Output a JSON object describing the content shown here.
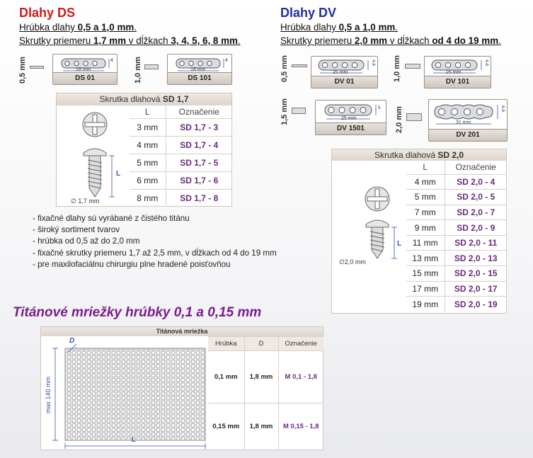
{
  "ds": {
    "title": "Dlahy DS",
    "spec1_pre": "Hrúbka dlahy ",
    "spec1_val": "0,5 a 1,0 mm",
    "spec1_post": ".",
    "spec2_pre": "Skrutky priemeru ",
    "spec2_val1": "1,7 mm",
    "spec2_mid": " v dĺžkach ",
    "spec2_val2": "3, 4, 5, 6, 8 mm",
    "spec2_post": ".",
    "plates": [
      {
        "thickness": "0,5 mm",
        "label": "DS 01",
        "dim": "18 mm",
        "side": "4"
      },
      {
        "thickness": "1,0 mm",
        "label": "DS 101",
        "dim": "18 mm",
        "side": "4"
      }
    ],
    "screw_table": {
      "title_pre": "Skrutka dlahová ",
      "title_val": "SD 1,7",
      "col_l": "L",
      "col_code": "Označenie",
      "rows": [
        {
          "l": "3 mm",
          "code": "SD 1,7 - 3"
        },
        {
          "l": "4 mm",
          "code": "SD 1,7 - 4"
        },
        {
          "l": "5 mm",
          "code": "SD 1,7 - 5"
        },
        {
          "l": "6 mm",
          "code": "SD 1,7 - 6"
        },
        {
          "l": "8 mm",
          "code": "SD 1,7 - 8"
        }
      ],
      "diameter": "∅ 1,7 mm",
      "len_label": "L"
    }
  },
  "dv": {
    "title": "Dlahy DV",
    "spec1_pre": "Hrúbka dlahy ",
    "spec1_val": "0,5 a 1,0 mm",
    "spec1_post": ".",
    "spec2_pre": "Skrutky priemeru ",
    "spec2_val1": "2,0 mm",
    "spec2_mid": " v dĺžkach ",
    "spec2_val2": "od 4 do 19 mm",
    "spec2_post": ".",
    "plates": [
      {
        "thickness": "0,5 mm",
        "label": "DV 01",
        "dim": "25 mm",
        "side": "4,6"
      },
      {
        "thickness": "1,0 mm",
        "label": "DV 101",
        "dim": "25 mm",
        "side": "4,6"
      },
      {
        "thickness": "1,5 mm",
        "label": "DV 1501",
        "dim": "25 mm",
        "side": "5"
      },
      {
        "thickness": "2,0 mm",
        "label": "DV 201",
        "dim": "31 mm",
        "side": "6,6"
      }
    ],
    "screw_table": {
      "title_pre": "Skrutka dlahová ",
      "title_val": "SD 2,0",
      "col_l": "L",
      "col_code": "Označenie",
      "rows": [
        {
          "l": "4 mm",
          "code": "SD 2,0 - 4"
        },
        {
          "l": "5 mm",
          "code": "SD 2,0 - 5"
        },
        {
          "l": "7 mm",
          "code": "SD 2,0 - 7"
        },
        {
          "l": "9 mm",
          "code": "SD 2,0 - 9"
        },
        {
          "l": "11 mm",
          "code": "SD 2,0 - 11"
        },
        {
          "l": "13 mm",
          "code": "SD 2,0 - 13"
        },
        {
          "l": "15 mm",
          "code": "SD 2,0 - 15"
        },
        {
          "l": "17 mm",
          "code": "SD 2,0 - 17"
        },
        {
          "l": "19 mm",
          "code": "SD 2,0 - 19"
        }
      ],
      "diameter": "∅2,0 mm",
      "len_label": "L"
    }
  },
  "bullets": [
    "- fixačné dlahy sú vyrábané z čistého titánu",
    "- široký sortiment tvarov",
    "- hrúbka od 0,5 až do 2,0 mm",
    "- fixačné skrutky priemeru 1,7 až 2,5 mm, v dĺžkach od 4 do 19 mm",
    "- pre maxilofaciálnu chirurgiu plne hradené poisťovňou"
  ],
  "mesh": {
    "title": "Titánové mriežky hrúbky 0,1 a 0,15 mm",
    "box_title": "Titánová mriežka",
    "vertical_label": "max 140 mm",
    "d_label": "D",
    "l_label": "L",
    "cols": [
      "Hrúbka",
      "D",
      "Označenie"
    ],
    "rows": [
      {
        "thickness": "0,1 mm",
        "d": "1,8 mm",
        "code": "M 0,1 - 1,8"
      },
      {
        "thickness": "0,15 mm",
        "d": "1,8 mm",
        "code": "M 0,15 - 1,8"
      }
    ]
  },
  "colors": {
    "ds_title": "#d21a1a",
    "dv_title": "#1f2fa6",
    "code": "#6b2a7d",
    "mesh_title": "#7a1d8c"
  }
}
